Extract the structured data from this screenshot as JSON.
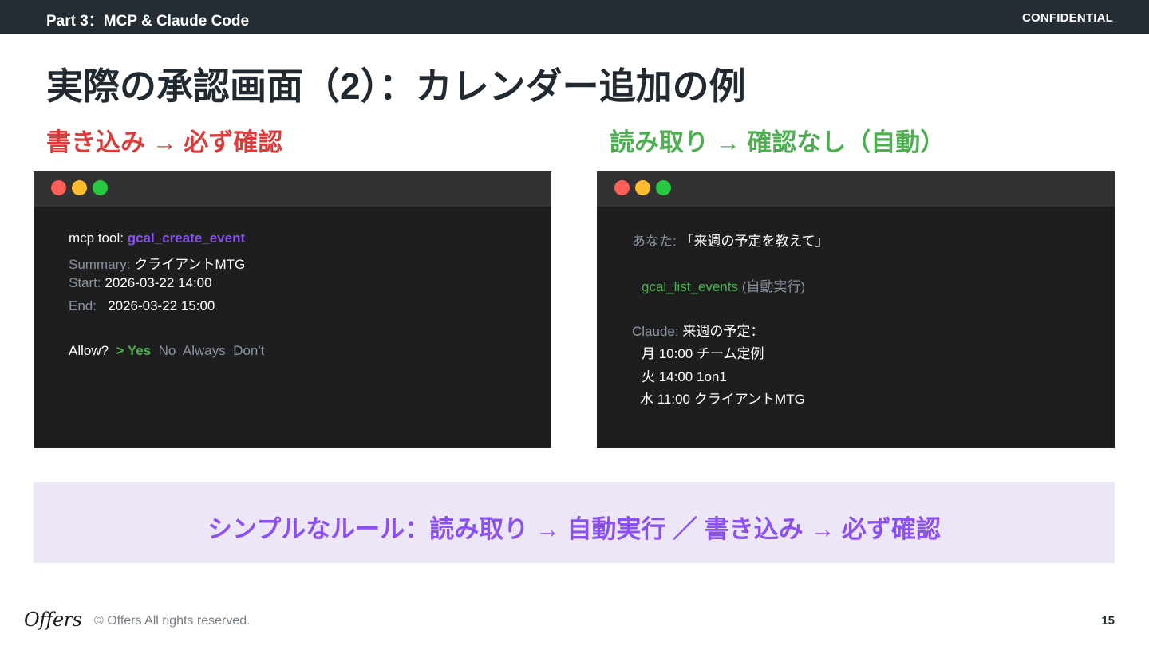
{
  "header": {
    "part": "Part 3：MCP & Claude Code",
    "confidential": "CONFIDENTIAL"
  },
  "title": "実際の承認画面（2）：カレンダー追加の例",
  "left_panel": {
    "heading": "書き込み → 必ず確認",
    "tool_label": "mcp tool: ",
    "tool_name": "gcal_create_event",
    "summary_label": "Summary: ",
    "summary_value": "クライアントMTG",
    "start_label": "Start: ",
    "start_value": "2026-03-22 14:00",
    "end_label": "End:   ",
    "end_value": "2026-03-22 15:00",
    "allow_label": "Allow?  ",
    "options": [
      "> Yes",
      "No",
      "Always",
      "Don't"
    ]
  },
  "right_panel": {
    "heading": "読み取り → 確認なし（自動）",
    "user_label": "あなた: ",
    "user_message": "「来週の予定を教えて」",
    "tool_name": "gcal_list_events",
    "tool_note": " (自動実行)",
    "claude_label": "Claude: ",
    "claude_message": "来週の予定：",
    "events": [
      "月 10:00 チーム定例",
      "火 14:00 1on1",
      "水 11:00 クライアントMTG"
    ]
  },
  "rule": "シンプルなルール：読み取り → 自動実行 ／ 書き込み → 必ず確認",
  "footer": {
    "logo": "Offers",
    "copyright": "© Offers All rights reserved.",
    "page": "15"
  },
  "colors": {
    "header_bg": "#242d34",
    "write_red": "#dd3a3a",
    "read_green": "#4caf50",
    "accent_purple": "#8a50f0",
    "terminal_bg": "#1e1e1e",
    "rule_bg": "#ede6f6"
  }
}
